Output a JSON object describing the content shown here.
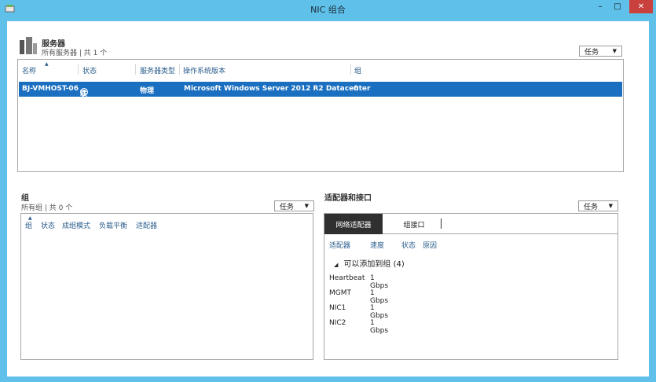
{
  "window": {
    "title": "NIC 组合",
    "minimize_glyph": "–",
    "maximize_glyph": "□",
    "close_glyph": "✕"
  },
  "servers": {
    "title": "服务器",
    "subtitle": "所有服务器 | 共 1 个",
    "tasks_label": "任务",
    "columns": [
      "名称",
      "状态",
      "服务器类型",
      "操作系统版本",
      "组"
    ],
    "row": {
      "name": "BJ-VMHOST-06",
      "status": "联机",
      "type": "物理",
      "os": "Microsoft Windows Server 2012 R2 Datacenter",
      "group": "0"
    }
  },
  "groups": {
    "title": "组",
    "subtitle": "所有组 | 共 0 个",
    "tasks_label": "任务",
    "columns": [
      "组",
      "状态",
      "成组模式",
      "负载平衡",
      "适配器"
    ]
  },
  "adapters": {
    "title": "适配器和接口",
    "tasks_label": "任务",
    "tabs": [
      "网络适配器",
      "组接口"
    ],
    "columns": [
      "适配器",
      "速度",
      "状态",
      "原因"
    ],
    "group_label": "可以添加到组 (4)",
    "rows": [
      {
        "name": "Heartbeat",
        "speed": "1 Gbps"
      },
      {
        "name": "MGMT",
        "speed": "1 Gbps"
      },
      {
        "name": "NIC1",
        "speed": "1 Gbps"
      },
      {
        "name": "NIC2",
        "speed": "1 Gbps"
      }
    ]
  },
  "colors": {
    "chrome": "#5fc1ea",
    "selection": "#1a6fc0",
    "close": "#c9403d",
    "active_tab": "#2f2f2f",
    "link": "#2a5d8c"
  }
}
